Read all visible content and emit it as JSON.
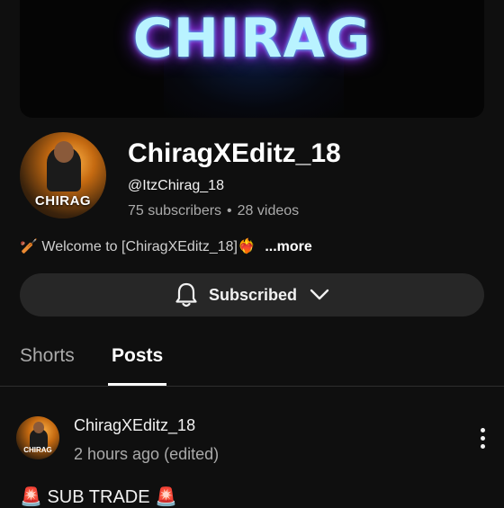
{
  "banner": {
    "text": "CHIRAG"
  },
  "channel": {
    "name": "ChiragXEditz_18",
    "handle": "@ItzChirag_18",
    "subscribers": "75 subscribers",
    "separator": "•",
    "videos": "28 videos",
    "avatar_tag": "CHIRAG",
    "description_prefix_emoji": "🏏",
    "description": "Welcome to [ChiragXEditz_18]",
    "description_suffix_emoji": "❤️‍🔥",
    "more_label": "...more"
  },
  "subscribe_button": {
    "label": "Subscribed",
    "icon": "bell-icon",
    "dropdown_icon": "chevron-down-icon"
  },
  "tabs": [
    {
      "label": "Shorts",
      "active": false
    },
    {
      "label": "Posts",
      "active": true
    }
  ],
  "post": {
    "author": "ChiragXEditz_18",
    "time": "2 hours ago (edited)",
    "avatar_tag": "CHIRAG",
    "text": "SUB TRADE",
    "text_emoji": "🚨"
  },
  "colors": {
    "background": "#0f0f0f",
    "button": "#272727",
    "secondary_text": "#aaaaaa"
  }
}
